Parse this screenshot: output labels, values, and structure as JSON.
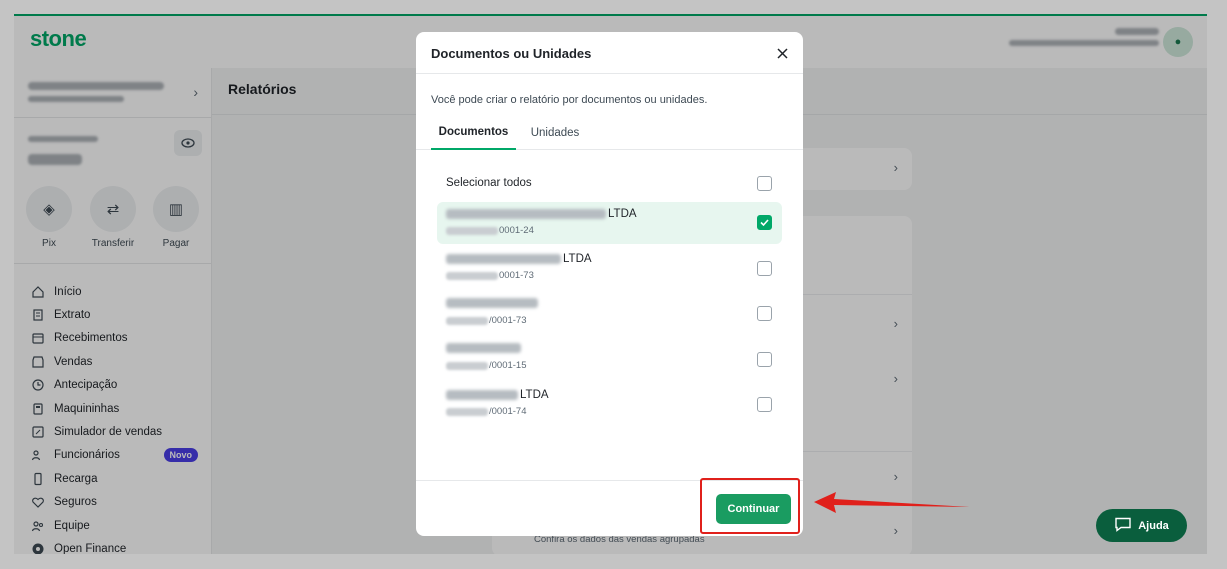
{
  "app": {
    "logo": "stone",
    "page_title": "Relatórios",
    "quick_actions": [
      {
        "label": "Pix",
        "icon": "pix-icon"
      },
      {
        "label": "Transferir",
        "icon": "transfer-icon"
      },
      {
        "label": "Pagar",
        "icon": "barcode-icon"
      }
    ],
    "nav": [
      {
        "label": "Início",
        "icon": "home-icon"
      },
      {
        "label": "Extrato",
        "icon": "statement-icon"
      },
      {
        "label": "Recebimentos",
        "icon": "receivables-icon"
      },
      {
        "label": "Vendas",
        "icon": "store-icon"
      },
      {
        "label": "Antecipação",
        "icon": "clock-icon"
      },
      {
        "label": "Maquininhas",
        "icon": "card-machine-icon"
      },
      {
        "label": "Simulador de vendas",
        "icon": "calculator-icon"
      },
      {
        "label": "Funcionários",
        "icon": "people-icon",
        "badge": "Novo"
      },
      {
        "label": "Recarga",
        "icon": "phone-icon"
      },
      {
        "label": "Seguros",
        "icon": "heart-icon"
      },
      {
        "label": "Equipe",
        "icon": "team-icon"
      },
      {
        "label": "Open Finance",
        "icon": "open-finance-icon"
      }
    ],
    "card_subtitle": "Confira os dados das vendas agrupadas",
    "help_button": "Ajuda",
    "brand_color": "#00a868"
  },
  "modal": {
    "title": "Documentos ou Unidades",
    "description": "Você pode criar o relatório por documentos ou unidades.",
    "tabs": [
      {
        "label": "Documentos",
        "active": true
      },
      {
        "label": "Unidades",
        "active": false
      }
    ],
    "select_all_label": "Selecionar todos",
    "select_all_checked": false,
    "documents": [
      {
        "name_suffix": "LTDA",
        "id_suffix": "0001-24",
        "checked": true
      },
      {
        "name_suffix": "LTDA",
        "id_suffix": "0001-73",
        "checked": false
      },
      {
        "name_suffix": "",
        "id_suffix": "/0001-73",
        "checked": false
      },
      {
        "name_suffix": "",
        "id_suffix": "/0001-15",
        "checked": false
      },
      {
        "name_suffix": "LTDA",
        "id_suffix": "/0001-74",
        "checked": false
      }
    ],
    "continue_button": "Continuar",
    "annotation_color": "#e0201b"
  }
}
